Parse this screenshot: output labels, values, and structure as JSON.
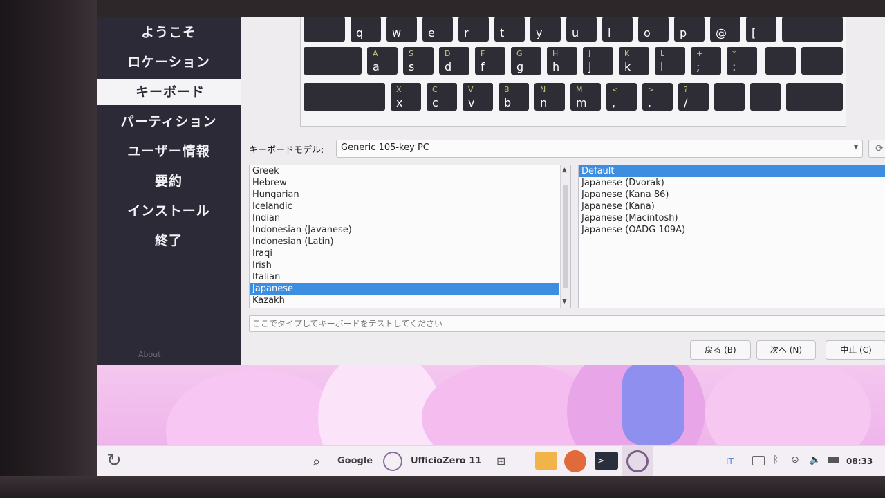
{
  "sidebar": {
    "items": [
      {
        "label": "ようこそ"
      },
      {
        "label": "ロケーション"
      },
      {
        "label": "キーボード"
      },
      {
        "label": "パーティション"
      },
      {
        "label": "ユーザー情報"
      },
      {
        "label": "要約"
      },
      {
        "label": "インストール"
      },
      {
        "label": "終了"
      }
    ],
    "active_index": 2,
    "about_label": "About"
  },
  "keyboard_preview": {
    "rows": [
      [
        {
          "up": "",
          "dn": "q"
        },
        {
          "up": "",
          "dn": "w"
        },
        {
          "up": "",
          "dn": "e"
        },
        {
          "up": "",
          "dn": "r"
        },
        {
          "up": "",
          "dn": "t"
        },
        {
          "up": "",
          "dn": "y"
        },
        {
          "up": "",
          "dn": "u"
        },
        {
          "up": "",
          "dn": "i"
        },
        {
          "up": "",
          "dn": "o"
        },
        {
          "up": "",
          "dn": "p"
        },
        {
          "up": "",
          "dn": "@"
        },
        {
          "up": "",
          "dn": "["
        }
      ],
      [
        {
          "up": "A",
          "dn": "a"
        },
        {
          "up": "S",
          "dn": "s"
        },
        {
          "up": "D",
          "dn": "d"
        },
        {
          "up": "F",
          "dn": "f"
        },
        {
          "up": "G",
          "dn": "g"
        },
        {
          "up": "H",
          "dn": "h"
        },
        {
          "up": "J",
          "dn": "j"
        },
        {
          "up": "K",
          "dn": "k"
        },
        {
          "up": "L",
          "dn": "l"
        },
        {
          "up": "+",
          "dn": ";"
        },
        {
          "up": "*",
          "dn": ":"
        }
      ],
      [
        {
          "up": "X",
          "dn": "x"
        },
        {
          "up": "C",
          "dn": "c"
        },
        {
          "up": "V",
          "dn": "v"
        },
        {
          "up": "B",
          "dn": "b"
        },
        {
          "up": "N",
          "dn": "n"
        },
        {
          "up": "M",
          "dn": "m"
        },
        {
          "up": "<",
          "dn": ","
        },
        {
          "up": ">",
          "dn": "."
        },
        {
          "up": "?",
          "dn": "/"
        }
      ]
    ]
  },
  "model": {
    "label": "キーボードモデル:",
    "value": "Generic 105-key PC"
  },
  "layouts": {
    "items": [
      "Greek",
      "Hebrew",
      "Hungarian",
      "Icelandic",
      "Indian",
      "Indonesian (Javanese)",
      "Indonesian (Latin)",
      "Iraqi",
      "Irish",
      "Italian",
      "Japanese",
      "Kazakh"
    ],
    "selected_index": 10
  },
  "variants": {
    "items": [
      "Default",
      "Japanese (Dvorak)",
      "Japanese (Kana 86)",
      "Japanese (Kana)",
      "Japanese (Macintosh)",
      "Japanese (OADG 109A)"
    ],
    "selected_index": 0
  },
  "test_input": {
    "placeholder": "ここでタイプしてキーボードをテストしてください"
  },
  "buttons": {
    "back": "戻る (B)",
    "next": "次へ (N)",
    "cancel": "中止 (C)"
  },
  "taskbar": {
    "search_label": "Google",
    "app_label": "UfficioZero 11",
    "lang": "IT",
    "time": "08:33"
  },
  "colors": {
    "sidebar_bg": "#2b2a36",
    "selection": "#3d8ee0",
    "wallpaper": "#f0b8ec"
  }
}
